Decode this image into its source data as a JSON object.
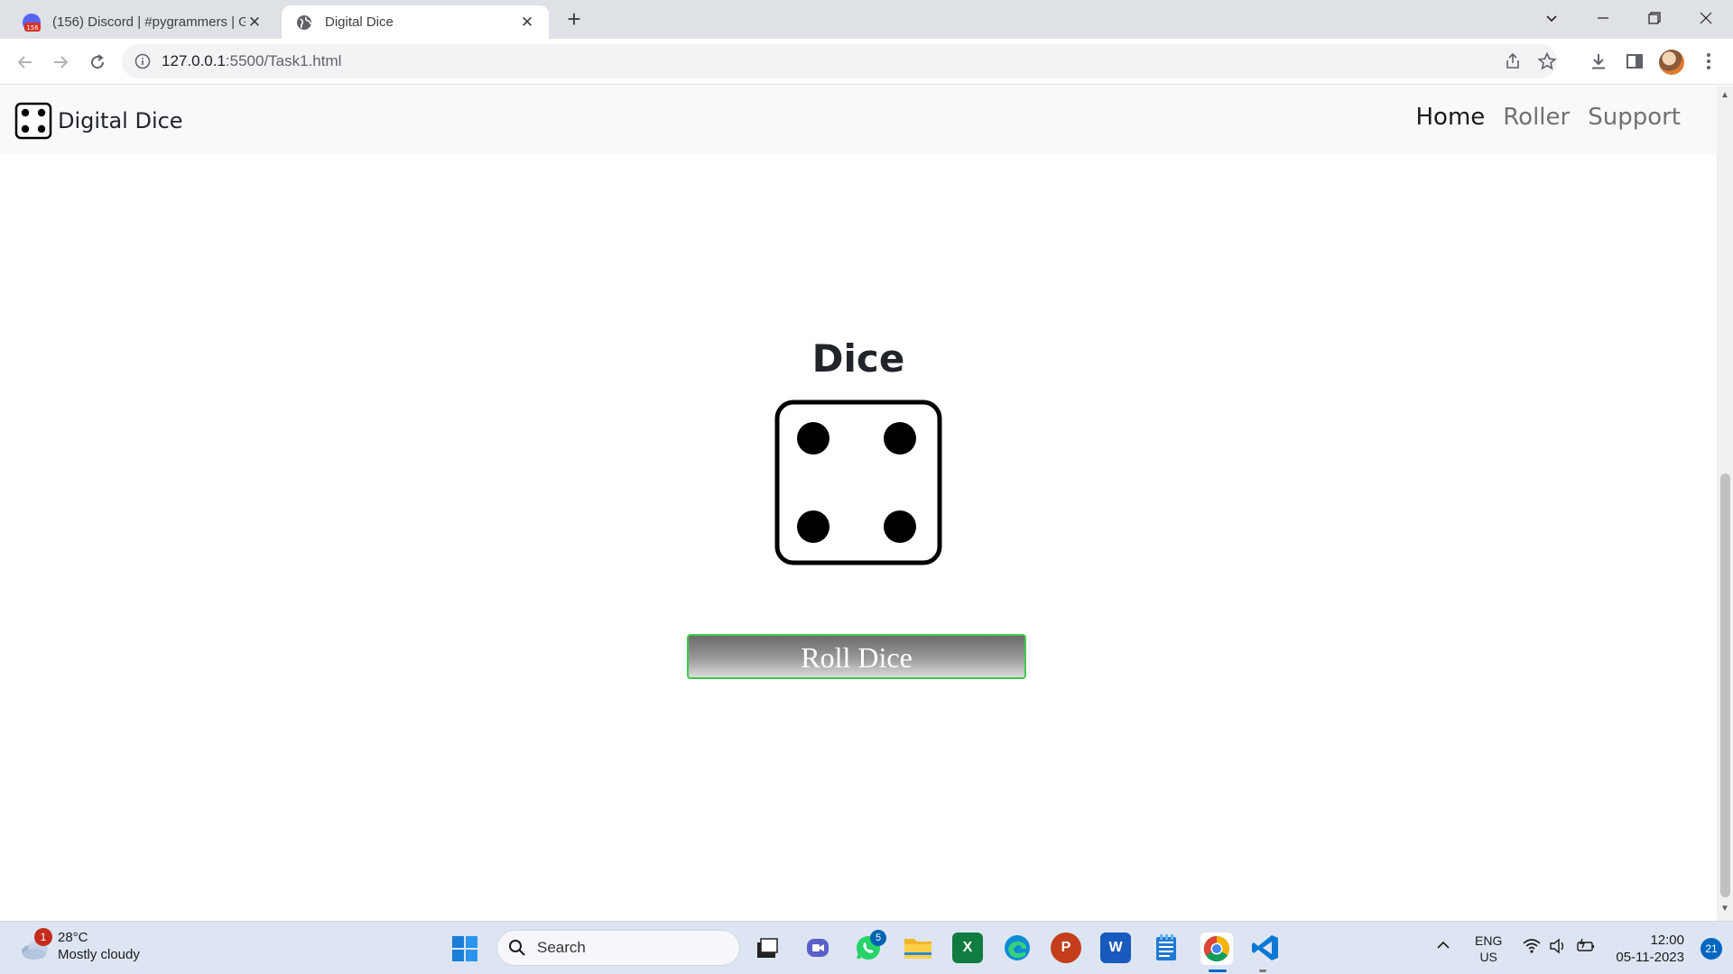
{
  "browser": {
    "tabs": [
      {
        "title": "(156) Discord | #pygrammers | G",
        "badge": "156",
        "active": false
      },
      {
        "title": "Digital Dice",
        "active": true
      }
    ],
    "url_host": "127.0.0.1",
    "url_path": ":5500/Task1.html"
  },
  "site": {
    "brand": "Digital Dice",
    "nav": [
      {
        "label": "Home",
        "active": true
      },
      {
        "label": "Roller",
        "active": false
      },
      {
        "label": "Support",
        "active": false
      }
    ]
  },
  "main": {
    "title": "Dice",
    "dice_face": 4,
    "roll_button": "Roll Dice"
  },
  "taskbar": {
    "weather_temp": "28°C",
    "weather_desc": "Mostly cloudy",
    "weather_badge": "1",
    "search_label": "Search",
    "teams_badge": "5",
    "lang_top": "ENG",
    "lang_bottom": "US",
    "time": "12:00",
    "date": "05-11-2023",
    "notifications": "21"
  },
  "colors": {
    "nav_bg": "#f8f9fa",
    "button_border": "#3fcb4f",
    "taskbar_bg": "#dde5f2"
  }
}
